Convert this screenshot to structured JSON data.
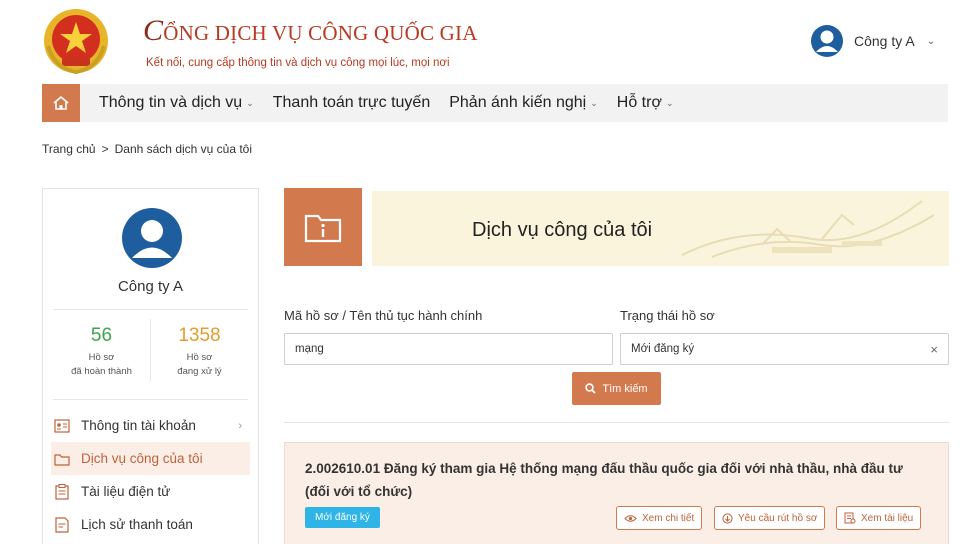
{
  "header": {
    "title_cap": "C",
    "title_rest": "ỔNG DỊCH VỤ CÔNG QUỐC GIA",
    "subtitle": "Kết nối, cung cấp thông tin và dịch vụ công mọi lúc, mọi nơi",
    "user_name": "Công ty A"
  },
  "nav": {
    "items": [
      {
        "label": "Thông tin và dịch vụ",
        "dropdown": true
      },
      {
        "label": "Thanh toán trực tuyến",
        "dropdown": false
      },
      {
        "label": "Phản ánh kiến nghị",
        "dropdown": true
      },
      {
        "label": "Hỗ trợ",
        "dropdown": true
      }
    ]
  },
  "breadcrumb": {
    "home": "Trang chủ",
    "separator": ">",
    "current": "Danh sách dịch vụ của tôi"
  },
  "sidebar": {
    "company": "Công ty A",
    "stats": [
      {
        "value": "56",
        "label_line1": "Hồ sơ",
        "label_line2": "đã hoàn thành",
        "color": "#3fa34d"
      },
      {
        "value": "1358",
        "label_line1": "Hồ sơ",
        "label_line2": "đang xử lý",
        "color": "#e89a2a"
      }
    ],
    "menu": [
      {
        "label": "Thông tin tài khoản",
        "icon": "id-card-icon",
        "active": false,
        "arrow": true
      },
      {
        "label": "Dịch vụ công của tôi",
        "icon": "folder-icon",
        "active": true,
        "arrow": false
      },
      {
        "label": "Tài liệu điện tử",
        "icon": "clipboard-icon",
        "active": false,
        "arrow": false
      },
      {
        "label": "Lịch sử thanh toán",
        "icon": "receipt-icon",
        "active": false,
        "arrow": false
      }
    ]
  },
  "main": {
    "title": "Dịch vụ công của tôi",
    "filters": {
      "code_label": "Mã hồ sơ / Tên thủ tục hành chính",
      "code_value": "mạng",
      "status_label": "Trạng thái hồ sơ",
      "status_value": "Mới đăng ký",
      "clear_glyph": "×",
      "search_button": "Tìm kiếm"
    },
    "record": {
      "title": "2.002610.01 Đăng ký tham gia Hệ thống mạng đấu thầu quốc gia đối với nhà thầu, nhà đầu tư (đối với tổ chức)",
      "status_badge": "Mới đăng ký",
      "actions": [
        {
          "label": "Xem chi tiết",
          "icon": "eye-icon"
        },
        {
          "label": "Yêu cầu rút hồ sơ",
          "icon": "withdraw-icon"
        },
        {
          "label": "Xem tài liệu",
          "icon": "document-icon"
        }
      ]
    }
  },
  "colors": {
    "accent": "#d27a4e",
    "brand_red": "#b83a22",
    "badge_blue": "#2eb4e6",
    "banner_bg": "#fbf4dc",
    "card_bg": "#fbeee6"
  }
}
